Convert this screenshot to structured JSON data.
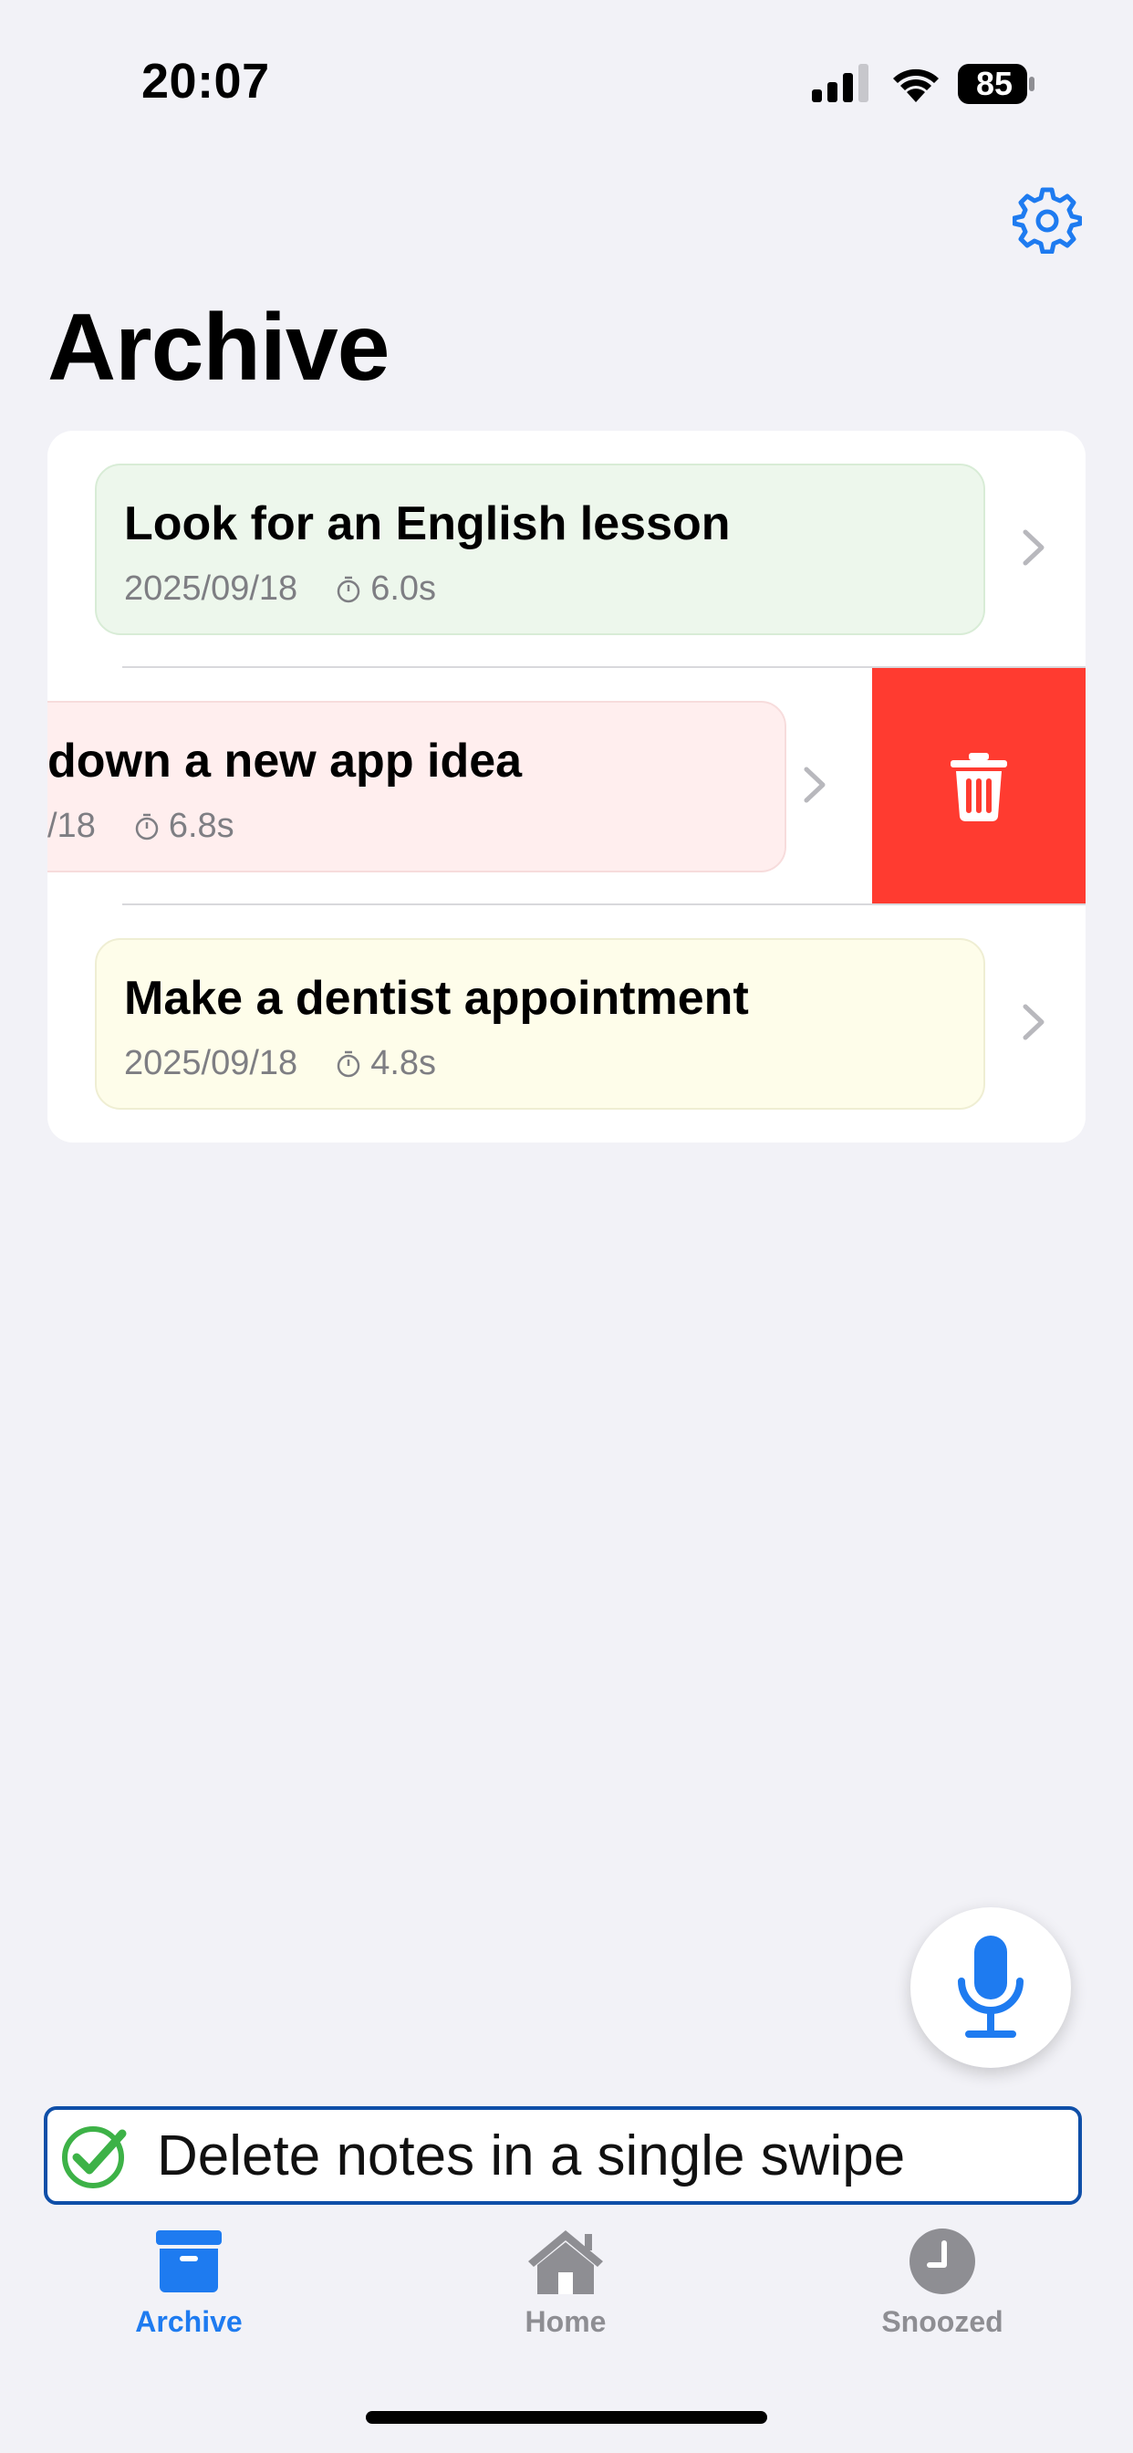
{
  "status_bar": {
    "time": "20:07",
    "battery": "85"
  },
  "page": {
    "title": "Archive"
  },
  "notes": [
    {
      "title": "Look for an English lesson",
      "date": "2025/09/18",
      "duration": "6.0s",
      "color": "#EDF7EC"
    },
    {
      "title": "down a new app idea",
      "date": "/18",
      "duration": "6.8s",
      "color": "#FFEEEE",
      "swiped": true
    },
    {
      "title": "Make a dentist appointment",
      "date": "2025/09/18",
      "duration": "4.8s",
      "color": "#FEFDEA"
    }
  ],
  "delete_action": {
    "icon": "trash-icon",
    "color": "#FF3B30"
  },
  "tip": {
    "text": "Delete notes in a single swipe"
  },
  "tabs": [
    {
      "label": "Archive",
      "icon": "archive-box-icon",
      "active": true
    },
    {
      "label": "Home",
      "icon": "house-icon",
      "active": false
    },
    {
      "label": "Snoozed",
      "icon": "clock-icon",
      "active": false
    }
  ],
  "colors": {
    "accent": "#1E7BF0",
    "destructive": "#FF3B30",
    "background": "#F2F2F7"
  }
}
